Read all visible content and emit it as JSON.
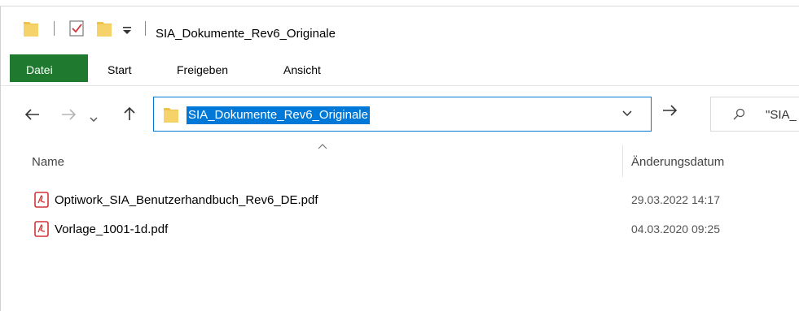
{
  "window": {
    "title": "SIA_Dokumente_Rev6_Originale"
  },
  "quick_access": {
    "customize_symbol": "⩡"
  },
  "ribbon": {
    "tabs": [
      "Datei",
      "Start",
      "Freigeben",
      "Ansicht"
    ],
    "active_color": "#1f7a2f"
  },
  "address_bar": {
    "path": "SIA_Dokumente_Rev6_Originale",
    "selection_color": "#0078d7"
  },
  "search": {
    "text": "\"SIA_"
  },
  "columns": {
    "name": "Name",
    "date": "Änderungsdatum"
  },
  "files": [
    {
      "name": "Optiwork_SIA_Benutzerhandbuch_Rev6_DE.pdf",
      "modified": "29.03.2022 14:17",
      "icon": "pdf-icon"
    },
    {
      "name": "Vorlage_1001-1d.pdf",
      "modified": "04.03.2020 09:25",
      "icon": "pdf-icon"
    }
  ]
}
